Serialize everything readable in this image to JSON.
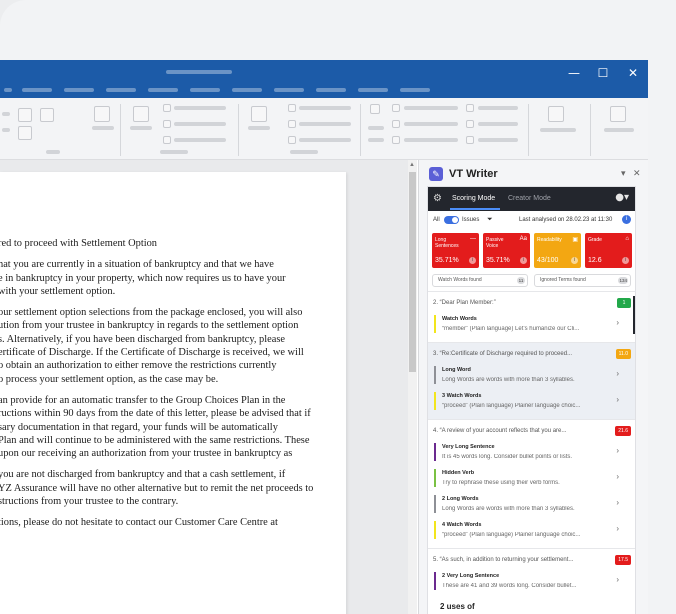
{
  "window": {
    "title": ""
  },
  "window_controls": {
    "minimize": "—",
    "maximize": "☐",
    "close": "✕"
  },
  "document": {
    "paragraphs": [
      [
        "red to proceed with Settlement Option"
      ],
      [
        "hat you are currently in a situation of bankruptcy and that we have",
        "e in bankruptcy in your property, which now requires us to have your",
        "with your settlement option."
      ],
      [
        "our settlement option selections from the package enclosed, you will also",
        "ution from your trustee in bankruptcy in regards to the settlement option",
        "s.  Alternatively, if you have been discharged from bankruptcy, please",
        "ertificate of Discharge.  If the Certificate of Discharge is received, we will",
        "o obtain an authorization to either remove the restrictions currently",
        "o process your settlement option, as the case may be."
      ],
      [
        "an provide for an automatic transfer to the Group Choices Plan in the",
        "ructions within 90 days from the date of this letter, please be advised that if",
        "sary documentation in that regard, your funds will be automatically",
        "Plan and will continue to be administered with the same restrictions.  These",
        "upon our receiving an authorization from your trustee in bankruptcy as"
      ],
      [
        "you are not discharged from bankruptcy and that a cash settlement, if",
        "YZ Assurance will have no other alternative but to remit the net proceeds to",
        "structions from your trustee to the contrary."
      ],
      [
        "tions, please do not hesitate to contact our Customer Care Centre at"
      ]
    ]
  },
  "pane": {
    "title": "VT Writer",
    "logo_icon": "pencil-icon",
    "pin_glyph": "▾",
    "close_glyph": "✕"
  },
  "plugin": {
    "settings_glyph": "⚙",
    "tabs": [
      "Scoring Mode",
      "Creator Mode"
    ],
    "account_glyph": "●▾",
    "filter": {
      "all_label": "All",
      "issues_label": "Issues",
      "funnel_glyph": "⏷",
      "last_analysed": "Last analysed on 28.02.23 at 11:30",
      "info_glyph": "i"
    },
    "scores": [
      {
        "label": "Long Sentences",
        "icon": "—",
        "value": "35.71%",
        "color": "#e31c1c"
      },
      {
        "label": "Passive Voice",
        "icon": "Aa",
        "value": "35.71%",
        "color": "#e31c1c"
      },
      {
        "label": "Readability",
        "icon": "▣",
        "value": "43/100",
        "color": "#f3a712"
      },
      {
        "label": "Grade",
        "icon": "⌂",
        "value": "12.6",
        "color": "#e31c1c"
      }
    ],
    "watch_words_found": {
      "label": "Watch Words found",
      "count": "11"
    },
    "ignored_terms_found": {
      "label": "Ignored Terms found",
      "count": "134"
    },
    "issues": [
      {
        "quote": "2. “Dear Plan Member:”",
        "badge": "1",
        "badge_color": "#22a84a",
        "highlight": false,
        "items": [
          {
            "title": "Watch Words",
            "desc": "“member” (Plain language) Let’s humanize our Cli...",
            "color": "#f2e51d"
          }
        ]
      },
      {
        "quote": "3. “Re:Certificate of Discharge required to proceed...",
        "badge": "11.0",
        "badge_color": "#f3a712",
        "highlight": true,
        "items": [
          {
            "title": "Long Word",
            "desc": "Long Words are words with more than 3 syllables.",
            "color": "#8e9096"
          },
          {
            "title": "3 Watch Words",
            "desc": "“proceed” (Plain language) Plainer language choic...",
            "color": "#f2e51d"
          }
        ]
      },
      {
        "quote": "4. “A review of your account reflects that you are...",
        "badge": "21.6",
        "badge_color": "#e31c1c",
        "highlight": false,
        "items": [
          {
            "title": "Very Long Sentence",
            "desc": "It is 45 words long. Consider bullet points or lists.",
            "color": "#6b2a8f"
          },
          {
            "title": "Hidden Verb",
            "desc": "Try to rephrase these using their verb forms.",
            "color": "#7ac143"
          },
          {
            "title": "2 Long Words",
            "desc": "Long Words are words with more than 3 syllables.",
            "color": "#8e9096"
          },
          {
            "title": "4 Watch Words",
            "desc": "“proceed” (Plain language) Plainer language choic...",
            "color": "#f2e51d"
          }
        ]
      },
      {
        "quote": "5. “As such, in addition to returning your settlement...",
        "badge": "17.5",
        "badge_color": "#e31c1c",
        "highlight": false,
        "items": [
          {
            "title": "2 Very Long Sentence",
            "desc": "These are 41 and 39 words long. Consider bullet...",
            "color": "#6b2a8f"
          }
        ]
      }
    ],
    "more_text": "2 uses of"
  }
}
